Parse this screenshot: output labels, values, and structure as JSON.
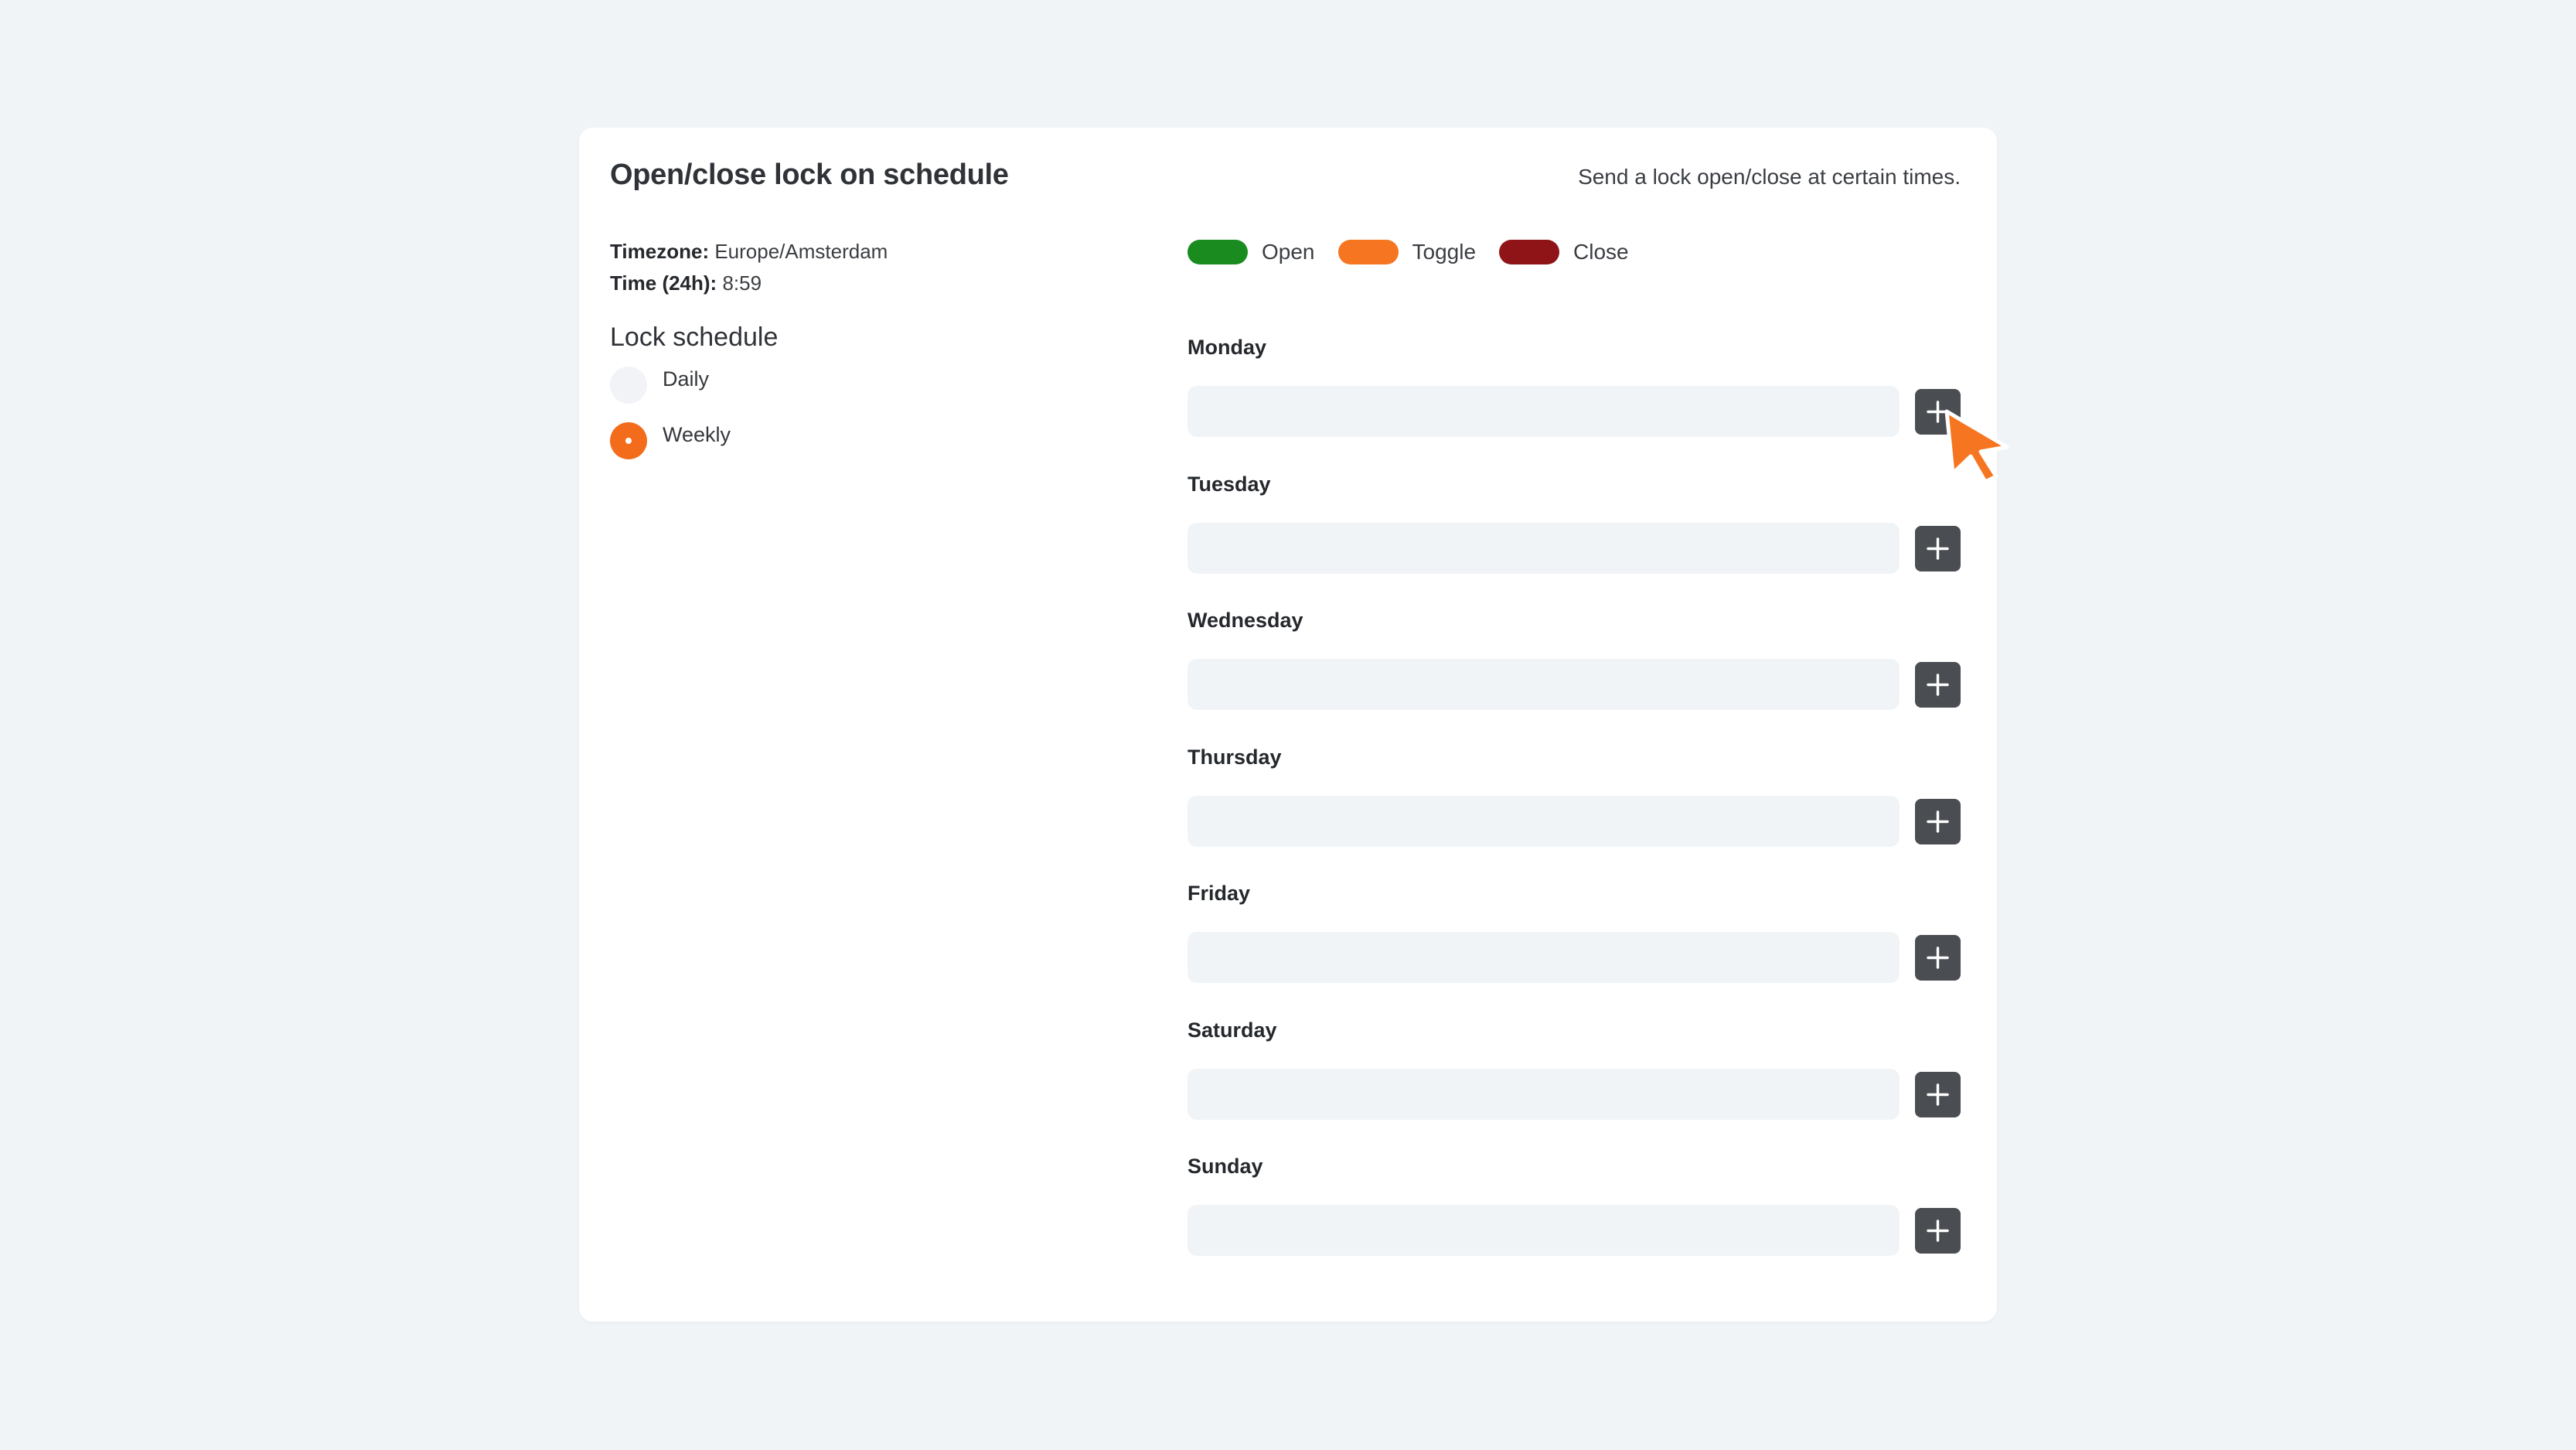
{
  "card": {
    "title": "Open/close lock on schedule",
    "description": "Send a lock open/close at certain times."
  },
  "info": {
    "timezone_label": "Timezone:",
    "timezone_value": "Europe/Amsterdam",
    "time_label": "Time (24h):",
    "time_value": "8:59"
  },
  "schedule": {
    "title": "Lock schedule",
    "options": [
      {
        "label": "Daily",
        "selected": false
      },
      {
        "label": "Weekly",
        "selected": true
      }
    ]
  },
  "legend": [
    {
      "label": "Open",
      "color": "#1a8c1f"
    },
    {
      "label": "Toggle",
      "color": "#f57520"
    },
    {
      "label": "Close",
      "color": "#8e1418"
    }
  ],
  "days": [
    {
      "label": "Monday",
      "value": ""
    },
    {
      "label": "Tuesday",
      "value": ""
    },
    {
      "label": "Wednesday",
      "value": ""
    },
    {
      "label": "Thursday",
      "value": ""
    },
    {
      "label": "Friday",
      "value": ""
    },
    {
      "label": "Saturday",
      "value": ""
    },
    {
      "label": "Sunday",
      "value": ""
    }
  ],
  "icons": {
    "add": "plus-icon",
    "cursor": "cursor-arrow-icon"
  },
  "colors": {
    "accent": "#f26c1c",
    "button": "#4a4d52",
    "background": "#f1f4f7"
  }
}
